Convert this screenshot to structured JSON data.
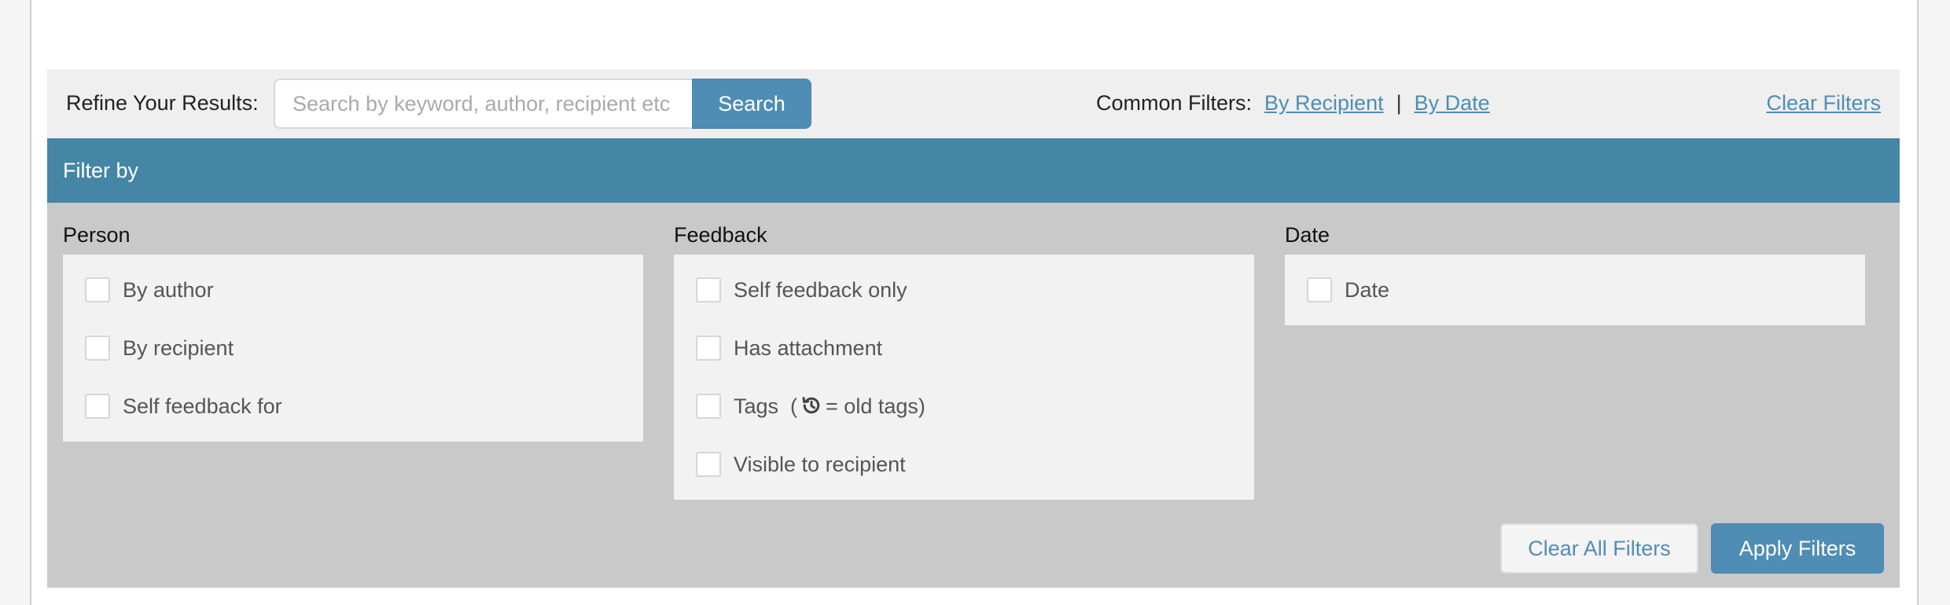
{
  "refine": {
    "label": "Refine Your Results:",
    "search_placeholder": "Search by keyword, author, recipient etc",
    "search_button": "Search"
  },
  "common_filters": {
    "label": "Common Filters:",
    "by_recipient": "By Recipient",
    "separator": "|",
    "by_date": "By Date"
  },
  "clear_filters": "Clear Filters",
  "filter_header": "Filter by",
  "groups": {
    "person": {
      "title": "Person",
      "options": [
        "By author",
        "By recipient",
        "Self feedback for"
      ]
    },
    "feedback": {
      "title": "Feedback",
      "options": [
        "Self feedback only",
        "Has attachment",
        "Visible to recipient"
      ],
      "tags": {
        "prefix": "Tags  (",
        "suffix": "= old tags)"
      }
    },
    "date": {
      "title": "Date",
      "options": [
        "Date"
      ]
    }
  },
  "actions": {
    "clear_all": "Clear All Filters",
    "apply": "Apply Filters"
  },
  "colors": {
    "accent": "#4f8db5",
    "header": "#4585a5",
    "panel_body": "#c9c9c9",
    "bar": "#efefef"
  },
  "icons": {
    "tags_legend": "history-icon"
  }
}
